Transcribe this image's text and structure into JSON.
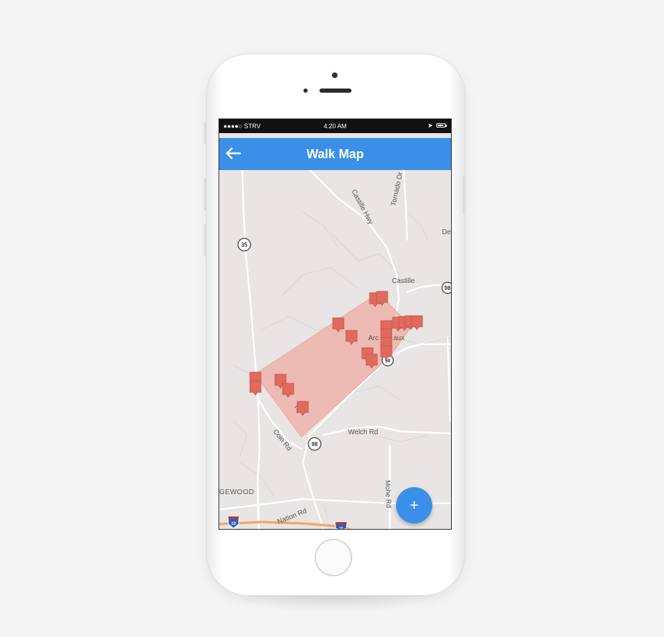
{
  "status_bar": {
    "carrier": "●●●●○ STRV",
    "time": "4:20 AM",
    "location_icon": "location-arrow-icon",
    "battery_icon": "battery-icon"
  },
  "app_bar": {
    "title": "Walk Map",
    "back_icon": "back-arrow-icon"
  },
  "map": {
    "streets": [
      "Castille Hwy",
      "Tornado Dr",
      "Castille",
      "Welch Rd",
      "Coin Rd",
      "Nation Rd",
      "Mche Rd",
      "GEWOOD",
      "Des",
      "Arc",
      "aux",
      "ng"
    ],
    "route_shields": [
      "35",
      "98",
      "98",
      "98",
      "10",
      "10"
    ],
    "walk_area_color": "#f0a8a0",
    "marker_color": "#e06a5d"
  },
  "fab": {
    "label": "+"
  }
}
